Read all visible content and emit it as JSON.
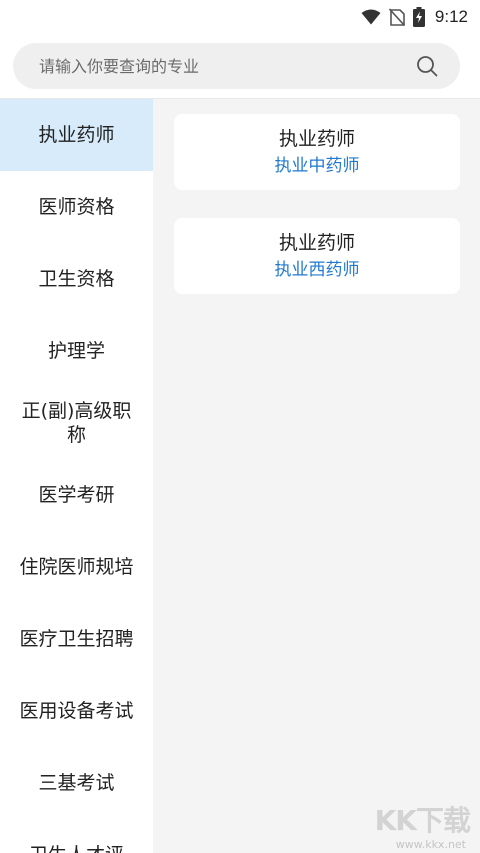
{
  "status_bar": {
    "time": "9:12",
    "icons": [
      "wifi-icon",
      "no-sim-icon",
      "battery-charging-icon"
    ]
  },
  "search": {
    "placeholder": "请输入你要查询的专业",
    "icon": "search-icon"
  },
  "sidebar": {
    "active_index": 0,
    "items": [
      {
        "label": "执业药师"
      },
      {
        "label": "医师资格"
      },
      {
        "label": "卫生资格"
      },
      {
        "label": "护理学"
      },
      {
        "label": "正(副)高级职称"
      },
      {
        "label": "医学考研"
      },
      {
        "label": "住院医师规培"
      },
      {
        "label": "医疗卫生招聘"
      },
      {
        "label": "医用设备考试"
      },
      {
        "label": "三基考试"
      },
      {
        "label": "卫生人才评"
      }
    ]
  },
  "content": {
    "cards": [
      {
        "title": "执业药师",
        "subtitle": "执业中药师"
      },
      {
        "title": "执业药师",
        "subtitle": "执业西药师"
      }
    ]
  },
  "watermark": {
    "logo": "KK下载",
    "url": "www.kkx.net"
  },
  "colors": {
    "active_bg": "#d8ebfb",
    "accent": "#1f78d1",
    "content_bg": "#f4f4f4",
    "search_bg": "#efefef"
  }
}
